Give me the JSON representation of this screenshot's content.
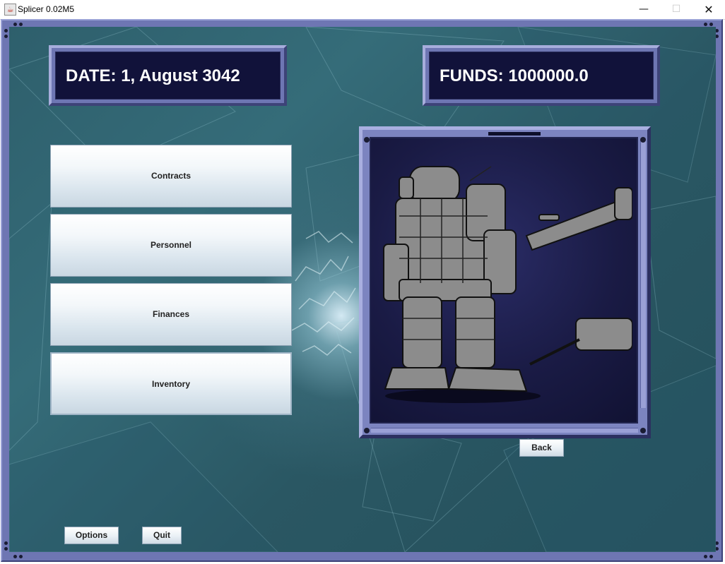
{
  "window": {
    "title": "Splicer 0.02M5",
    "app_icon": "java-cup-icon",
    "minimize_glyph": "—",
    "maximize_glyph": "☐",
    "close_glyph": "✕"
  },
  "header": {
    "date_text": "DATE: 1, August 3042",
    "funds_text": "FUNDS: 1000000.0"
  },
  "menu": {
    "items": [
      {
        "label": "Contracts"
      },
      {
        "label": "Personnel"
      },
      {
        "label": "Finances"
      },
      {
        "label": "Inventory",
        "selected": true
      }
    ]
  },
  "viewer": {
    "image": "battlemech-illustration"
  },
  "buttons": {
    "back": "Back",
    "options": "Options",
    "quit": "Quit"
  },
  "colors": {
    "frame": "#6e76b3",
    "panel_bg": "#11123a",
    "background": "#2e5f6c"
  }
}
